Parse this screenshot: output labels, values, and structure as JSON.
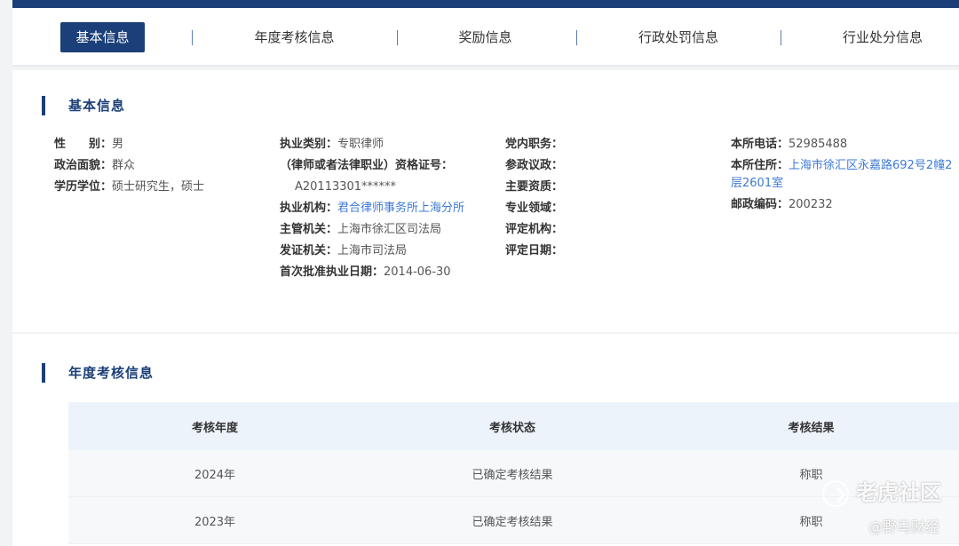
{
  "tabs": [
    {
      "label": "基本信息",
      "active": true
    },
    {
      "label": "年度考核信息",
      "active": false
    },
    {
      "label": "奖励信息",
      "active": false
    },
    {
      "label": "行政处罚信息",
      "active": false
    },
    {
      "label": "行业处分信息",
      "active": false
    }
  ],
  "basic": {
    "title": "基本信息",
    "col1": [
      {
        "label": "性　　别：",
        "value": "男"
      },
      {
        "label": "政治面貌：",
        "value": "群众"
      },
      {
        "label": "学历学位：",
        "value": "硕士研究生，硕士"
      }
    ],
    "col2": {
      "practice_type": {
        "label": "执业类别：",
        "value": "专职律师"
      },
      "certificate": {
        "label": "（律师或者法律职业）资格证号：",
        "value": "A20113301******"
      },
      "institution": {
        "label": "执业机构：",
        "value": "君合律师事务所上海分所"
      },
      "authority": {
        "label": "主管机关：",
        "value": "上海市徐汇区司法局"
      },
      "issuer": {
        "label": "发证机关：",
        "value": "上海市司法局"
      },
      "first_date": {
        "label": "首次批准执业日期：",
        "value": "2014-06-30"
      }
    },
    "col3": [
      {
        "label": "党内职务：",
        "value": ""
      },
      {
        "label": "参政议政：",
        "value": ""
      },
      {
        "label": "主要资质：",
        "value": ""
      },
      {
        "label": "专业领域：",
        "value": ""
      },
      {
        "label": "评定机构：",
        "value": ""
      },
      {
        "label": "评定日期：",
        "value": ""
      }
    ],
    "col4": {
      "phone": {
        "label": "本所电话：",
        "value": "52985488"
      },
      "address": {
        "label": "本所住所：",
        "value_line1": "上海市徐汇区永嘉路692号2幢2",
        "value_line2": "层2601室"
      },
      "postcode": {
        "label": "邮政编码：",
        "value": "200232"
      }
    }
  },
  "annual": {
    "title": "年度考核信息",
    "headers": [
      "考核年度",
      "考核状态",
      "考核结果"
    ],
    "rows": [
      [
        "2024年",
        "已确定考核结果",
        "称职"
      ],
      [
        "2023年",
        "已确定考核结果",
        "称职"
      ]
    ]
  },
  "watermark": {
    "main": "老虎社区",
    "sub": "@野马财经"
  },
  "colors": {
    "brand": "#1b3f78",
    "link": "#3d7ad6",
    "table_header": "#edf3fb"
  }
}
